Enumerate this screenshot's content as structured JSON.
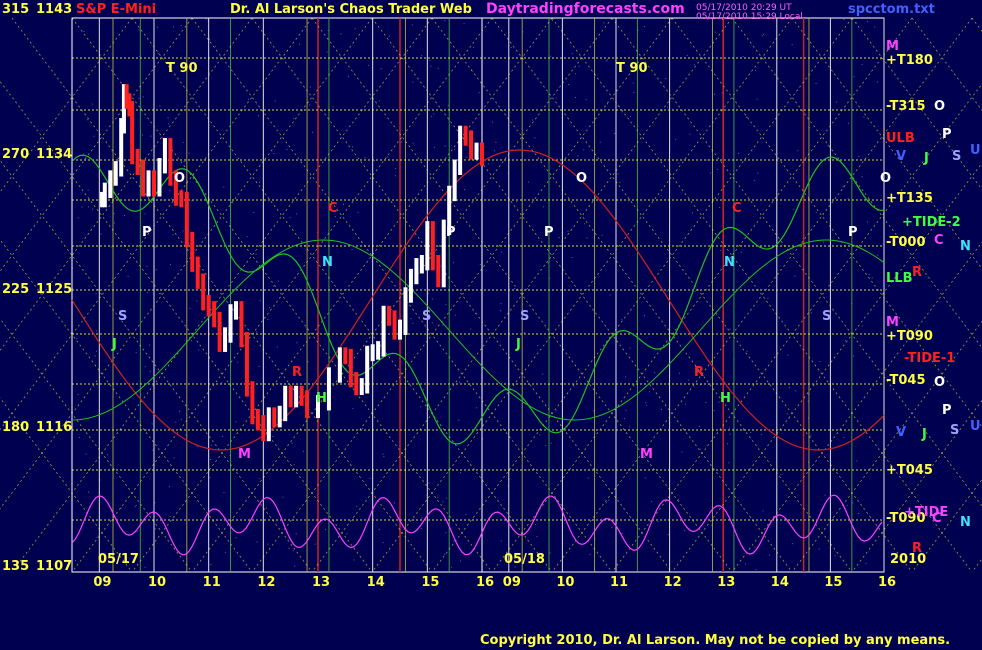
{
  "header": {
    "instrument": "S&P E-Mini",
    "title": "Dr. Al Larson's Chaos Trader Web",
    "site": "Daytradingforecasts.com",
    "stamp_line1": "05/17/2010 20:29 UT",
    "stamp_line2": "05/17/2010 15:29 Local",
    "file": "spcctom.txt",
    "top_left_angle": "315",
    "top_left_price": "1143"
  },
  "footer": {
    "copyright": "Copyright 2010, Dr. Al Larson. May not be copied by any means.",
    "year": "2010",
    "date_left": "05/17",
    "date_right": "05/18"
  },
  "colors": {
    "background": "#000050",
    "price_up": "#ffffff",
    "price_down": "#ff2020",
    "chaos_clock": "#ffff40",
    "grid": "#c0c0c0",
    "tide": "#ff40ff",
    "green_line": "#20c020",
    "red_line": "#d02020"
  },
  "chart_data": {
    "type": "line",
    "title": "S&P E-Mini",
    "y_axis": [
      {
        "angle": "315",
        "price": "1143",
        "value": 1143
      },
      {
        "angle": "270",
        "price": "1134",
        "value": 1134
      },
      {
        "angle": "225",
        "price": "1125",
        "value": 1125
      },
      {
        "angle": "180",
        "price": "1116",
        "value": 1116
      },
      {
        "angle": "135",
        "price": "1107",
        "value": 1107
      }
    ],
    "ylim": [
      1107,
      1143
    ],
    "x_ticks_session1": [
      "09",
      "10",
      "11",
      "12",
      "13",
      "14",
      "15",
      "16"
    ],
    "x_ticks_session2": [
      "09",
      "10",
      "11",
      "12",
      "13",
      "14",
      "15",
      "16"
    ],
    "price_series": [
      [
        9.05,
        1131.2
      ],
      [
        9.1,
        1131.8
      ],
      [
        9.2,
        1132.6
      ],
      [
        9.3,
        1133.2
      ],
      [
        9.4,
        1136.0
      ],
      [
        9.45,
        1138.2
      ],
      [
        9.5,
        1137.6
      ],
      [
        9.55,
        1137.1
      ],
      [
        9.6,
        1134.0
      ],
      [
        9.7,
        1133.3
      ],
      [
        9.8,
        1131.9
      ],
      [
        9.9,
        1132.6
      ],
      [
        10.0,
        1131.9
      ],
      [
        10.1,
        1133.4
      ],
      [
        10.2,
        1134.7
      ],
      [
        10.3,
        1132.6
      ],
      [
        10.4,
        1131.3
      ],
      [
        10.5,
        1131.2
      ],
      [
        10.6,
        1128.6
      ],
      [
        10.7,
        1127.0
      ],
      [
        10.8,
        1125.9
      ],
      [
        10.9,
        1124.5
      ],
      [
        11.0,
        1124.1
      ],
      [
        11.1,
        1123.4
      ],
      [
        11.2,
        1121.8
      ],
      [
        11.3,
        1122.4
      ],
      [
        11.4,
        1123.9
      ],
      [
        11.5,
        1124.1
      ],
      [
        11.6,
        1122.1
      ],
      [
        11.7,
        1118.9
      ],
      [
        11.8,
        1117.1
      ],
      [
        11.9,
        1116.7
      ],
      [
        12.0,
        1116.0
      ],
      [
        12.1,
        1117.2
      ],
      [
        12.2,
        1116.9
      ],
      [
        12.3,
        1117.3
      ],
      [
        12.4,
        1118.6
      ],
      [
        12.5,
        1118.2
      ],
      [
        12.6,
        1118.6
      ],
      [
        12.7,
        1118.3
      ],
      [
        12.8,
        1117.5
      ],
      [
        13.0,
        1118.0
      ],
      [
        13.2,
        1119.8
      ],
      [
        13.4,
        1121.1
      ],
      [
        13.5,
        1121.0
      ],
      [
        13.6,
        1119.5
      ],
      [
        13.7,
        1119.0
      ],
      [
        13.8,
        1119.1
      ],
      [
        13.9,
        1121.2
      ],
      [
        14.0,
        1121.3
      ],
      [
        14.1,
        1121.5
      ],
      [
        14.2,
        1123.8
      ],
      [
        14.3,
        1123.5
      ],
      [
        14.4,
        1122.6
      ],
      [
        14.5,
        1122.9
      ],
      [
        14.6,
        1125.0
      ],
      [
        14.7,
        1126.2
      ],
      [
        14.8,
        1126.9
      ],
      [
        14.9,
        1127.1
      ],
      [
        15.0,
        1129.3
      ],
      [
        15.1,
        1127.1
      ],
      [
        15.2,
        1126.0
      ],
      [
        15.3,
        1129.4
      ],
      [
        15.4,
        1131.6
      ],
      [
        15.5,
        1133.3
      ],
      [
        15.6,
        1135.5
      ],
      [
        15.7,
        1135.2
      ],
      [
        15.8,
        1134.3
      ],
      [
        15.9,
        1134.4
      ],
      [
        16.0,
        1133.9
      ]
    ],
    "chaos_clock_labels": [
      "+T180",
      "-T315",
      "+T135",
      "-T000",
      "+T090",
      "-T045",
      "+T045",
      "-T090"
    ],
    "right_labels": [
      "M",
      "ULB",
      "+TIDE-2",
      "LLB",
      "M",
      "-TIDE-1",
      "+TIDE"
    ],
    "planet_labels_top": [
      "O",
      "P",
      "V",
      "J",
      "S",
      "U"
    ],
    "planet_labels_bottom": [
      "O",
      "P",
      "V",
      "J",
      "S",
      "U"
    ],
    "field_labels_right": [
      "C",
      "N",
      "R",
      "C",
      "N",
      "R"
    ],
    "annotations": [
      "T 90",
      "T 90",
      "O",
      "P",
      "S",
      "J",
      "N",
      "C",
      "M",
      "R",
      "H"
    ],
    "grid": true
  }
}
